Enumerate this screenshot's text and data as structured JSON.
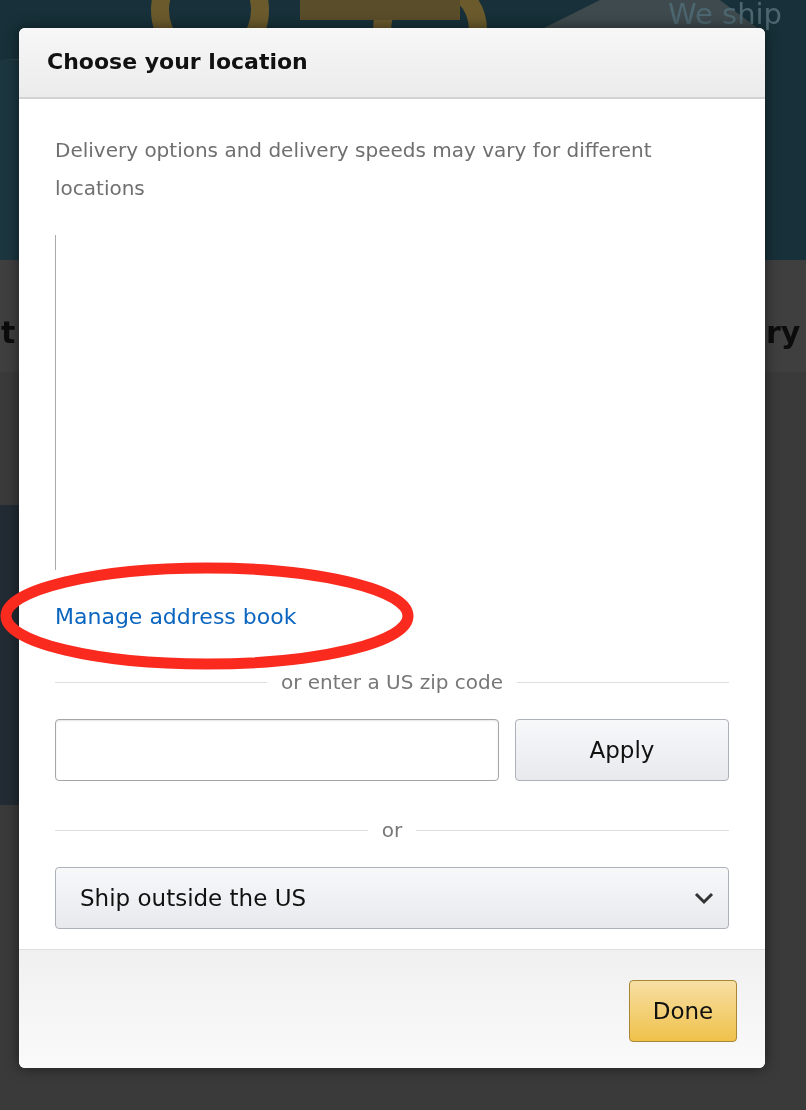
{
  "background": {
    "banner_text": "We ship",
    "left_heading": "t",
    "right_heading": "ry"
  },
  "dialog": {
    "title": "Choose your location",
    "description": "Delivery options and delivery speeds may vary for different locations",
    "address_link": "Manage address book",
    "zip_divider": "or enter a US zip code",
    "apply_button": "Apply",
    "or_divider": "or",
    "country_select": {
      "value": "Ship outside the US"
    },
    "done_button": "Done"
  },
  "highlight": {
    "kind": "ellipse"
  }
}
